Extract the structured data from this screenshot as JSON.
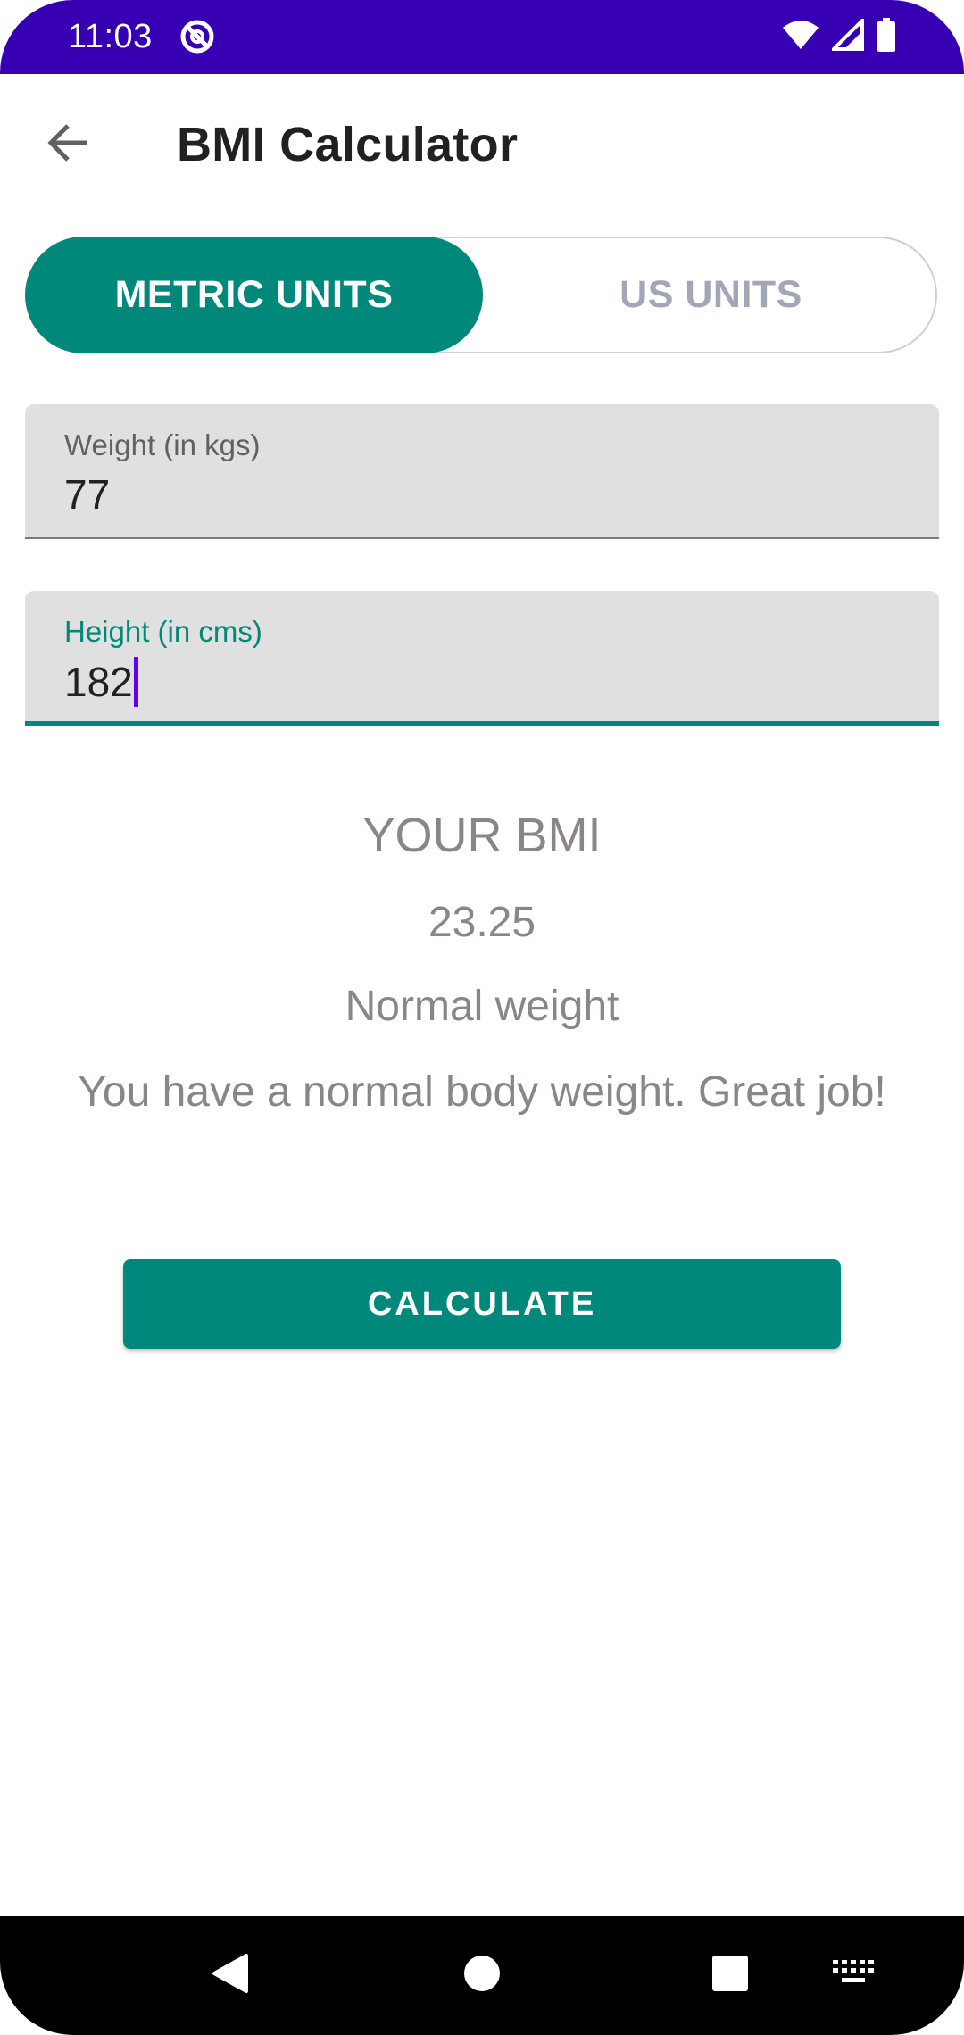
{
  "status_bar": {
    "time": "11:03",
    "icons": [
      "at-sign-app-icon",
      "wifi-icon",
      "signal-icon",
      "battery-icon"
    ]
  },
  "app_bar": {
    "title": "BMI Calculator",
    "back_icon": "arrow-back-icon"
  },
  "unit_toggle": {
    "options": [
      {
        "label": "METRIC UNITS",
        "selected": true
      },
      {
        "label": "US UNITS",
        "selected": false
      }
    ]
  },
  "form": {
    "weight": {
      "label": "Weight (in kgs)",
      "value": "77"
    },
    "height": {
      "label": "Height (in cms)",
      "value": "182",
      "focused": true
    }
  },
  "result": {
    "heading": "YOUR BMI",
    "value": "23.25",
    "category": "Normal weight",
    "message": "You have a normal body weight. Great job!"
  },
  "actions": {
    "calculate_label": "CALCULATE"
  },
  "nav_bar": {
    "icons": [
      "back-triangle-icon",
      "home-circle-icon",
      "recents-square-icon",
      "keyboard-icon"
    ]
  },
  "colors": {
    "status_bar": "#3700b3",
    "accent": "#00897b",
    "cursor": "#6200ee",
    "field_bg": "#e0e0e0",
    "result_text": "#8a8587"
  }
}
